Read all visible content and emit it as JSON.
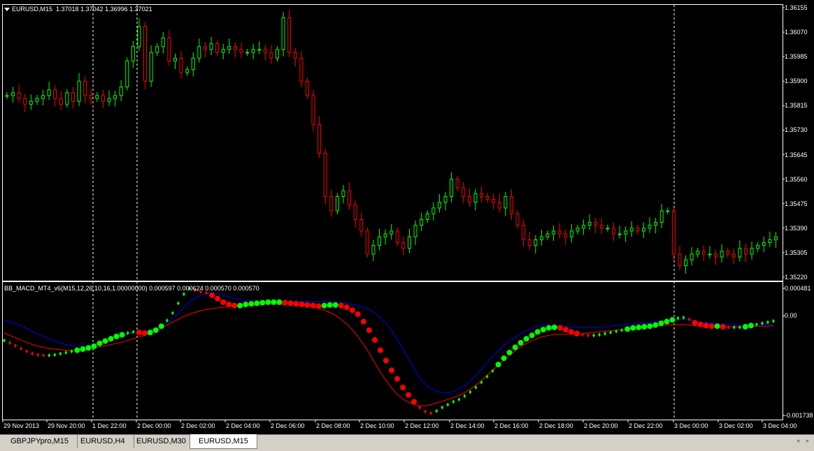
{
  "main_chart": {
    "symbol_label": "EURUSD,M15",
    "ohlc_label": "1.37018 1.37042 1.36996 1.37021",
    "price_min": 1.3522,
    "price_max": 1.36155,
    "price_ticks": [
      "1.36155",
      "1.36070",
      "1.35985",
      "1.35900",
      "1.35815",
      "1.35730",
      "1.35645",
      "1.35560",
      "1.35475",
      "1.35390",
      "1.35305",
      "1.35220"
    ],
    "bull_color": "#00ff00",
    "bear_color": "#ff0000",
    "closes": [
      1.3585,
      1.3586,
      1.3584,
      1.3582,
      1.3583,
      1.3584,
      1.3585,
      1.3587,
      1.3584,
      1.3582,
      1.3586,
      1.3583,
      1.359,
      1.3585,
      1.3584,
      1.3585,
      1.3583,
      1.3584,
      1.3585,
      1.3588,
      1.3597,
      1.3602,
      1.3609,
      1.359,
      1.36,
      1.3602,
      1.3605,
      1.3597,
      1.3598,
      1.3593,
      1.3594,
      1.3598,
      1.3602,
      1.3601,
      1.3603,
      1.36,
      1.3601,
      1.3602,
      1.3601,
      1.36,
      1.36,
      1.3601,
      1.3601,
      1.36,
      1.3598,
      1.3601,
      1.3612,
      1.36,
      1.3598,
      1.359,
      1.3585,
      1.3575,
      1.3565,
      1.355,
      1.3545,
      1.355,
      1.3552,
      1.3547,
      1.3542,
      1.3538,
      1.353,
      1.3533,
      1.3536,
      1.3537,
      1.3538,
      1.3534,
      1.3532,
      1.3536,
      1.354,
      1.3542,
      1.3544,
      1.3546,
      1.3548,
      1.355,
      1.3556,
      1.3553,
      1.355,
      1.3548,
      1.3551,
      1.355,
      1.3549,
      1.3548,
      1.3546,
      1.355,
      1.3544,
      1.354,
      1.3535,
      1.3533,
      1.3535,
      1.3536,
      1.3537,
      1.3538,
      1.3537,
      1.3536,
      1.3538,
      1.3539,
      1.354,
      1.3541,
      1.354,
      1.3539,
      1.3539,
      1.3537,
      1.3537,
      1.3538,
      1.3539,
      1.3538,
      1.3539,
      1.354,
      1.3541,
      1.3545,
      1.3545,
      1.353,
      1.3526,
      1.3528,
      1.353,
      1.3531,
      1.353,
      1.353,
      1.3529,
      1.3531,
      1.353,
      1.3529,
      1.3532,
      1.353,
      1.3532,
      1.3533,
      1.3534,
      1.3535,
      1.3536
    ],
    "vlines": [
      "29 Nov 21:45",
      "2 Dec 00:00",
      "3 Dec 00:00"
    ]
  },
  "indicator": {
    "label": "BB_MACD_MT4_v6(M15,12,26,10,16,1.00000000) 0.000597 0.000624 0.000570 0.000570",
    "ticks": [
      "0.000481",
      "0.00",
      "-0.001738"
    ],
    "min": -0.001738,
    "max": 0.000481,
    "upper_band_color": "#0000ff",
    "lower_band_color": "#ff0000",
    "macd_up_color": "#00ff00",
    "macd_down_color": "#ff0000",
    "macd": [
      -0.00043,
      -0.00047,
      -0.00052,
      -0.00057,
      -0.00062,
      -0.00066,
      -0.00068,
      -0.00069,
      -0.00069,
      -0.00068,
      -0.00066,
      -0.00064,
      -0.00062,
      -0.0006,
      -0.00058,
      -0.00056,
      -0.00053,
      -0.00048,
      -0.00044,
      -0.0004,
      -0.00036,
      -0.00033,
      -0.0003,
      -0.00028,
      -0.00029,
      -0.0003,
      -0.00029,
      -0.00025,
      -0.00018,
      -8e-05,
      5e-05,
      0.00022,
      0.00038,
      0.00048,
      0.00045,
      0.00042,
      0.0004,
      0.00036,
      0.0003,
      0.00024,
      0.0002,
      0.00018,
      0.00018,
      0.0002,
      0.00021,
      0.00022,
      0.00023,
      0.00024,
      0.00024,
      0.00024,
      0.00023,
      0.00022,
      0.00021,
      0.0002,
      0.00019,
      0.00018,
      0.00017,
      0.00018,
      0.00019,
      0.00019,
      0.00018,
      0.00015,
      0.0001,
      3e-05,
      -0.0001,
      -0.00025,
      -0.00042,
      -0.0006,
      -0.00078,
      -0.00095,
      -0.0011,
      -0.00125,
      -0.00138,
      -0.0015,
      -0.0016,
      -0.00167,
      -0.0017,
      -0.00166,
      -0.0016,
      -0.00155,
      -0.0015,
      -0.00146,
      -0.0014,
      -0.00133,
      -0.00125,
      -0.00116,
      -0.00106,
      -0.00096,
      -0.00085,
      -0.00074,
      -0.00064,
      -0.00055,
      -0.00047,
      -0.0004,
      -0.00034,
      -0.00028,
      -0.00024,
      -0.00021,
      -0.0002,
      -0.00021,
      -0.00024,
      -0.00028,
      -0.00031,
      -0.00033,
      -0.00034,
      -0.00034,
      -0.00033,
      -0.00031,
      -0.00029,
      -0.00027,
      -0.00025,
      -0.00023,
      -0.00021,
      -0.0002,
      -0.00019,
      -0.00018,
      -0.00016,
      -0.00013,
      -0.0001,
      -7e-05,
      -4e-05,
      -3e-05,
      -6e-05,
      -0.00012,
      -0.00015,
      -0.00017,
      -0.00018,
      -0.00018,
      -0.00019,
      -0.0002,
      -0.0002,
      -0.0002,
      -0.00019,
      -0.00017,
      -0.00015,
      -0.00013,
      -0.00011,
      -9e-05
    ],
    "upper": [
      -8e-05,
      -0.0001,
      -0.00013,
      -0.00017,
      -0.00022,
      -0.00027,
      -0.00032,
      -0.00036,
      -0.0004,
      -0.00044,
      -0.00047,
      -0.0005,
      -0.00052,
      -0.00053,
      -0.00053,
      -0.00052,
      -0.0005,
      -0.00047,
      -0.00043,
      -0.00039,
      -0.00036,
      -0.00033,
      -0.00031,
      -0.00029,
      -0.00028,
      -0.00027,
      -0.00025,
      -0.00022,
      -0.00018,
      -0.00012,
      -5e-05,
      5e-05,
      0.00015,
      0.00024,
      0.00031,
      0.00036,
      0.00039,
      0.0004,
      0.00039,
      0.00036,
      0.00033,
      0.0003,
      0.00028,
      0.00027,
      0.00026,
      0.00026,
      0.00025,
      0.00025,
      0.00025,
      0.00025,
      0.00025,
      0.00025,
      0.00025,
      0.00025,
      0.00025,
      0.00025,
      0.00025,
      0.00025,
      0.00025,
      0.00024,
      0.00023,
      0.00022,
      0.0002,
      0.00018,
      0.00015,
      0.00011,
      5e-05,
      -3e-05,
      -0.00013,
      -0.00026,
      -0.00041,
      -0.00058,
      -0.00075,
      -0.00092,
      -0.00108,
      -0.0012,
      -0.00128,
      -0.00132,
      -0.00134,
      -0.00134,
      -0.00132,
      -0.00128,
      -0.00122,
      -0.00114,
      -0.00104,
      -0.00093,
      -0.00082,
      -0.00071,
      -0.00061,
      -0.00052,
      -0.00044,
      -0.00037,
      -0.00031,
      -0.00026,
      -0.00022,
      -0.00019,
      -0.00017,
      -0.00016,
      -0.00016,
      -0.00017,
      -0.00018,
      -0.00019,
      -0.0002,
      -0.0002,
      -0.0002,
      -0.0002,
      -0.0002,
      -0.00019,
      -0.00018,
      -0.00017,
      -0.00016,
      -0.00015,
      -0.00014,
      -0.00013,
      -0.00012,
      -0.00011,
      -0.0001,
      -9e-05,
      -8e-05,
      -7e-05,
      -6e-05,
      -6e-05,
      -7e-05,
      -9e-05,
      -0.00011,
      -0.00012,
      -0.00013,
      -0.00014,
      -0.00015,
      -0.00015,
      -0.00016,
      -0.00016,
      -0.00016,
      -0.00016,
      -0.00016,
      -0.00015,
      -0.00015,
      -0.00014
    ],
    "lower": [
      -0.0003,
      -0.00034,
      -0.00038,
      -0.00042,
      -0.00046,
      -0.0005,
      -0.00053,
      -0.00055,
      -0.00057,
      -0.00058,
      -0.00059,
      -0.0006,
      -0.0006,
      -0.0006,
      -0.00059,
      -0.00058,
      -0.00056,
      -0.00054,
      -0.00052,
      -0.0005,
      -0.00048,
      -0.00046,
      -0.00043,
      -0.0004,
      -0.00037,
      -0.00034,
      -0.0003,
      -0.00026,
      -0.00021,
      -0.00016,
      -0.00011,
      -6e-05,
      -1e-05,
      3e-05,
      6e-05,
      9e-05,
      0.00011,
      0.00013,
      0.00014,
      0.00015,
      0.00016,
      0.00017,
      0.00018,
      0.00018,
      0.00019,
      0.00019,
      0.0002,
      0.0002,
      0.0002,
      0.0002,
      0.0002,
      0.0002,
      0.0002,
      0.00019,
      0.00018,
      0.00016,
      0.00013,
      0.0001,
      6e-05,
      1e-05,
      -6e-05,
      -0.00014,
      -0.00024,
      -0.00036,
      -0.0005,
      -0.00065,
      -0.00082,
      -0.00098,
      -0.00113,
      -0.00126,
      -0.00137,
      -0.00145,
      -0.00151,
      -0.00155,
      -0.00157,
      -0.00157,
      -0.00155,
      -0.00152,
      -0.00149,
      -0.00146,
      -0.00143,
      -0.00139,
      -0.00134,
      -0.00128,
      -0.00121,
      -0.00113,
      -0.00104,
      -0.00095,
      -0.00086,
      -0.00077,
      -0.00069,
      -0.00061,
      -0.00054,
      -0.00048,
      -0.00043,
      -0.00039,
      -0.00036,
      -0.00034,
      -0.00033,
      -0.00032,
      -0.00032,
      -0.00032,
      -0.00032,
      -0.00031,
      -0.0003,
      -0.00029,
      -0.00028,
      -0.00027,
      -0.00026,
      -0.00025,
      -0.00024,
      -0.00023,
      -0.00022,
      -0.00021,
      -0.0002,
      -0.00019,
      -0.00018,
      -0.00017,
      -0.00016,
      -0.00015,
      -0.00015,
      -0.00015,
      -0.00016,
      -0.00017,
      -0.00018,
      -0.00018,
      -0.00019,
      -0.00019,
      -0.00019,
      -0.00019,
      -0.00019,
      -0.00019,
      -0.00019,
      -0.00019,
      -0.00018,
      -0.00018,
      -0.00018,
      -0.00017
    ]
  },
  "time_axis": [
    "29 Nov 2013",
    "29 Nov 20:00",
    "1 Dec 22:00",
    "2 Dec 00:00",
    "2 Dec 02:00",
    "2 Dec 04:00",
    "2 Dec 06:00",
    "2 Dec 08:00",
    "2 Dec 10:00",
    "2 Dec 12:00",
    "2 Dec 14:00",
    "2 Dec 16:00",
    "2 Dec 18:00",
    "2 Dec 20:00",
    "2 Dec 22:00",
    "3 Dec 00:00",
    "3 Dec 02:00",
    "3 Dec 04:00"
  ],
  "tabs": [
    {
      "label": "GBPJPYpro,M15",
      "active": false
    },
    {
      "label": "EURUSD,H4",
      "active": false
    },
    {
      "label": "EURUSD,M30",
      "active": false
    },
    {
      "label": "EURUSD,M15",
      "active": true
    }
  ],
  "scroll_left": "◂",
  "scroll_right": "▸"
}
